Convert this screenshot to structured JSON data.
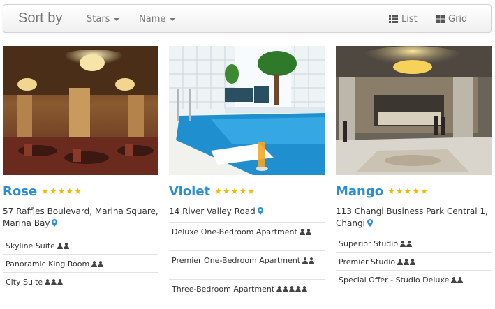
{
  "toolbar": {
    "brand": "Sort by",
    "sort_stars": "Stars",
    "sort_name": "Name",
    "view_list": "List",
    "view_grid": "Grid"
  },
  "hotels": [
    {
      "name": "Rose",
      "stars": 5,
      "address": "57 Raffles Boulevard, Marina Square, Marina Bay",
      "rooms": [
        {
          "name": "Skyline Suite",
          "guests": 2
        },
        {
          "name": "Panoramic King Room",
          "guests": 2
        },
        {
          "name": "City Suite",
          "guests": 3
        }
      ]
    },
    {
      "name": "Violet",
      "stars": 5,
      "address": "14 River Valley Road",
      "rooms": [
        {
          "name": "Deluxe One-Bedroom Apartment",
          "guests": 2
        },
        {
          "name": "Premier One-Bedroom Apartment",
          "guests": 2
        },
        {
          "name": "Three-Bedroom Apartment",
          "guests": 5
        }
      ]
    },
    {
      "name": "Mango",
      "stars": 5,
      "address": "113 Changi Business Park Central 1, Changi",
      "rooms": [
        {
          "name": "Superior Studio",
          "guests": 2
        },
        {
          "name": "Premier Studio",
          "guests": 3
        },
        {
          "name": "Special Offer - Studio Deluxe",
          "guests": 2
        }
      ]
    }
  ],
  "colors": {
    "accent": "#2a8fd6",
    "star": "#f5b800",
    "text": "#333333",
    "muted": "#777777"
  },
  "icons": {
    "star": "star-icon",
    "pin": "map-marker-icon",
    "guest": "user-icon",
    "list": "th-list-icon",
    "grid": "th-large-icon"
  }
}
